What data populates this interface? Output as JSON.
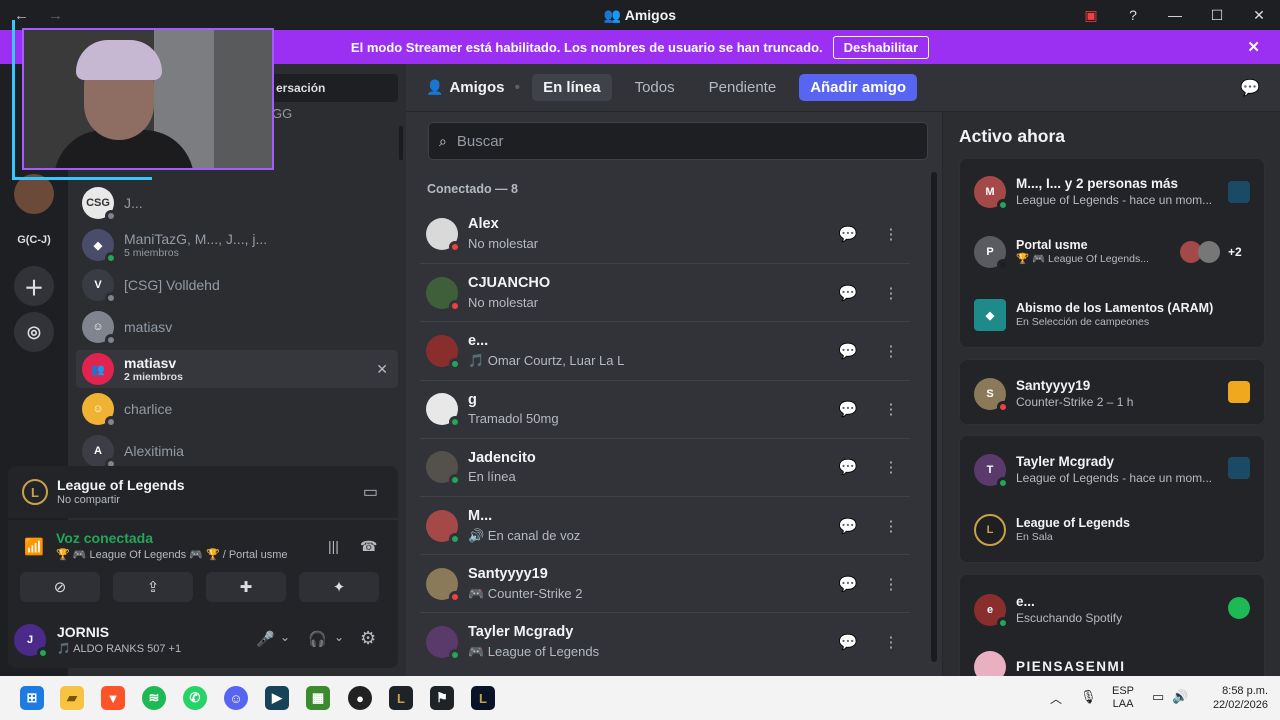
{
  "window": {
    "title": "Amigos",
    "back": "←",
    "forward": "→"
  },
  "banner": {
    "text": "El modo Streamer está habilitado. Los nombres de usuario se han truncado.",
    "button": "Deshabilitar",
    "close": "✕"
  },
  "guilds": {
    "label": "G(C-J)"
  },
  "dm": {
    "search_placeholder": "ersación",
    "partial_text": "GG",
    "items": [
      {
        "name": "J...",
        "sub": ""
      },
      {
        "name": "ManiTazG, M..., J..., j...",
        "sub": "5 miembros"
      },
      {
        "name": "[CSG] Volldehd",
        "sub": ""
      },
      {
        "name": "matiasv",
        "sub": ""
      },
      {
        "name": "matiasv",
        "sub": "2 miembros"
      },
      {
        "name": "charlice",
        "sub": ""
      },
      {
        "name": "Alexitimia",
        "sub": ""
      }
    ],
    "close_icon": "✕"
  },
  "activity": {
    "title": "League of Legends",
    "sub": "No compartir"
  },
  "voice": {
    "title": "Voz conectada",
    "sub": "🏆 🎮 League Of Legends 🎮 🏆 / Portal usme"
  },
  "user": {
    "name": "JORNIS",
    "status": "🎵 ALDO RANKS 507 +1"
  },
  "tabs": {
    "friends": "Amigos",
    "online": "En línea",
    "all": "Todos",
    "pending": "Pendiente",
    "add": "Añadir amigo"
  },
  "search": {
    "placeholder": "Buscar"
  },
  "section": {
    "label": "Conectado — 8"
  },
  "friends": [
    {
      "name": "Alex",
      "status": "No molestar",
      "st": "#f23f43",
      "color": "#d9d9d9"
    },
    {
      "name": "CJUANCHO",
      "status": "No molestar",
      "st": "#f23f43",
      "color": "#3f5f3a"
    },
    {
      "name": "e...",
      "status": "🎵 Omar Courtz, Luar La L",
      "st": "#23a55a",
      "color": "#8a2d2d"
    },
    {
      "name": "g",
      "status": "Tramadol 50mg",
      "st": "#23a55a",
      "color": "#e8e8e8"
    },
    {
      "name": "Jadencito",
      "status": "En línea",
      "st": "#23a55a",
      "color": "#54514c"
    },
    {
      "name": "M...",
      "status": "🔊 En canal de voz",
      "st": "#23a55a",
      "color": "#a44848"
    },
    {
      "name": "Santyyyy19",
      "status": "🎮 Counter-Strike 2",
      "st": "#f23f43",
      "color": "#8a7a5a"
    },
    {
      "name": "Tayler Mcgrady",
      "status": "🎮 League of Legends",
      "st": "#23a55a",
      "color": "#5a3a6a"
    }
  ],
  "active_now": {
    "title": "Activo ahora",
    "cards": [
      {
        "name": "M..., I... y 2 personas más",
        "sub": "League of Legends - hace un mom..."
      },
      {
        "name": "Portal usme",
        "sub": "🏆 🎮 League Of Legends...",
        "extra": "+2"
      },
      {
        "name": "Abismo de los Lamentos (ARAM)",
        "sub": "En Selección de campeones"
      },
      {
        "name": "Santyyyy19",
        "sub": "Counter-Strike 2 – 1 h"
      },
      {
        "name": "Tayler Mcgrady",
        "sub": "League of Legends - hace un mom..."
      },
      {
        "name": "League of Legends",
        "sub": "En Sala"
      },
      {
        "name": "e...",
        "sub": "Escuchando Spotify"
      },
      {
        "name": "PIENSASENMI",
        "sub": ""
      }
    ]
  },
  "taskbar": {
    "lang1": "ESP",
    "lang2": "LAA",
    "time": "8:58 p.m.",
    "date": "22/02/2026"
  },
  "colors": {
    "accent": "#5865f2",
    "banner": "#9b2ff2",
    "online": "#23a55a",
    "dnd": "#f23f43",
    "voice_green": "#23a55a"
  }
}
